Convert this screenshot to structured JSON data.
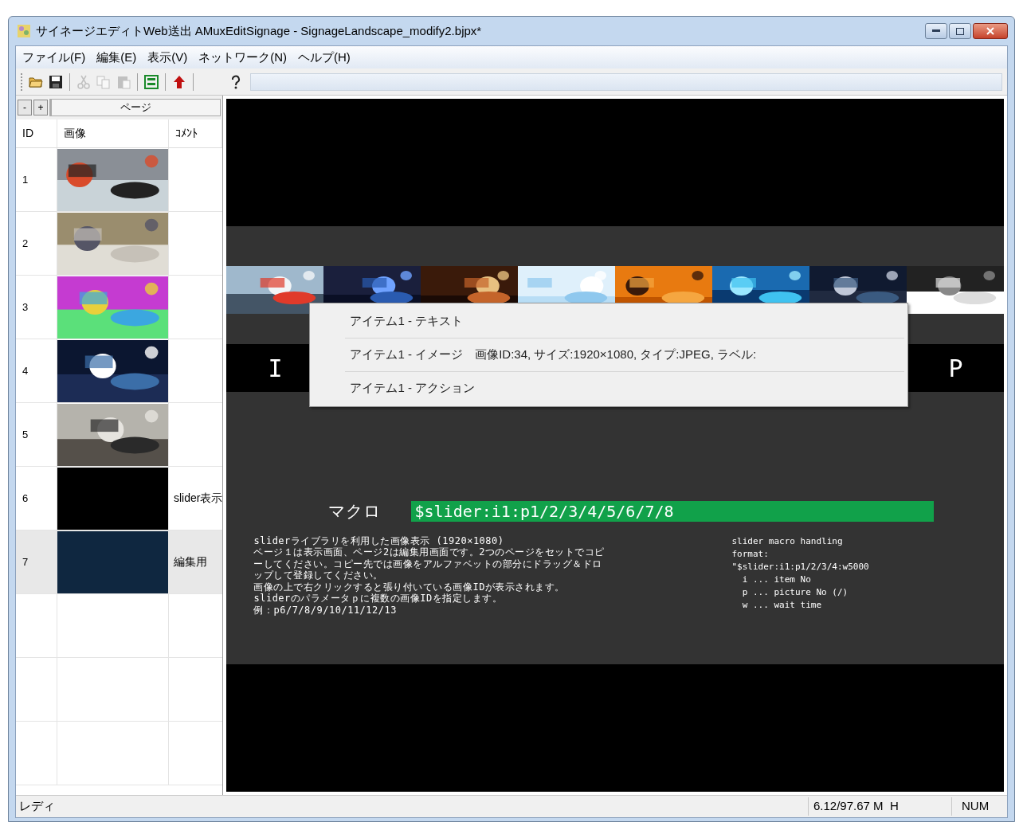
{
  "window": {
    "title": "サイネージエディトWeb送出 AMuxEditSignage - SignageLandscape_modify2.bjpx*"
  },
  "menu": [
    "ファイル(F)",
    "編集(E)",
    "表示(V)",
    "ネットワーク(N)",
    "ヘルプ(H)"
  ],
  "toolbar": [
    {
      "kind": "open",
      "disabled": false
    },
    {
      "kind": "save",
      "disabled": false
    },
    {
      "kind": "sep"
    },
    {
      "kind": "cut",
      "disabled": true
    },
    {
      "kind": "copy",
      "disabled": true
    },
    {
      "kind": "paste",
      "disabled": true
    },
    {
      "kind": "sep"
    },
    {
      "kind": "layout",
      "disabled": false
    },
    {
      "kind": "sep"
    },
    {
      "kind": "upload",
      "disabled": false
    },
    {
      "kind": "sep"
    },
    {
      "kind": "help",
      "disabled": false
    }
  ],
  "pages_panel": {
    "collapse": "-",
    "expand": "+",
    "title": "ページ",
    "columns": [
      "ID",
      "画像",
      "ｺﾒﾝﾄ"
    ],
    "rows": [
      {
        "id": "1",
        "kind": "picture",
        "selected": false
      },
      {
        "id": "2",
        "kind": "picture",
        "selected": false
      },
      {
        "id": "3",
        "kind": "picture",
        "selected": false
      },
      {
        "id": "4",
        "kind": "picture",
        "selected": false
      },
      {
        "id": "5",
        "kind": "picture",
        "selected": false
      },
      {
        "id": "6",
        "kind": "solid",
        "color": "#000000",
        "comment": "slider表示",
        "selected": false
      },
      {
        "id": "7",
        "kind": "solid",
        "color": "#0f2740",
        "comment": "編集用",
        "selected": true
      }
    ]
  },
  "canvas": {
    "strip": [
      {
        "kind": "picture"
      },
      {
        "kind": "picture"
      },
      {
        "kind": "picture"
      },
      {
        "kind": "picture"
      },
      {
        "kind": "picture"
      },
      {
        "kind": "picture"
      },
      {
        "kind": "picture"
      },
      {
        "kind": "picture"
      }
    ],
    "left_letter": "I",
    "right_letter": "P",
    "macro_label": "マクロ",
    "macro_value": "$slider:i1:p1/2/3/4/5/6/7/8",
    "description": [
      "sliderライブラリを利用した画像表示 (1920×1080)",
      "ページ１は表示画面、ページ2は編集用画面です。2つのページをセットでコピ",
      "ーしてください。コピー先では画像をアルファベットの部分にドラッグ＆ドロ",
      "ップして登録してください。",
      "画像の上で右クリックすると張り付いている画像IDが表示されます。",
      "sliderのパラメータｐに複数の画像IDを指定します。",
      "例：p6/7/8/9/10/11/12/13"
    ],
    "help": [
      "slider macro handling",
      "format:",
      "\"$slider:i1:p1/2/3/4:w5000",
      "  i ... item No",
      "  p ... picture No (/)",
      "  w ... wait time"
    ]
  },
  "context_menu": [
    "アイテム1 - テキスト",
    "アイテム1 - イメージ　画像ID:34, サイズ:1920×1080, タイプ:JPEG, ラベル:",
    "アイテム1 - アクション"
  ],
  "status_bar": {
    "message": "レディ",
    "memory": "6.12/97.67 M  H",
    "num": "NUM"
  }
}
